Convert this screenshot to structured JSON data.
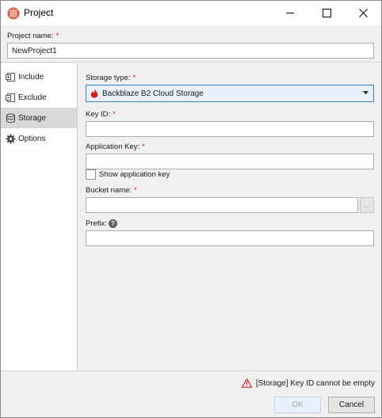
{
  "window": {
    "title": "Project",
    "app_icon": "project-app-icon",
    "controls": [
      "minimize-icon",
      "maximize-icon",
      "close-icon"
    ]
  },
  "project_name": {
    "label": "Project name:",
    "required_mark": "*",
    "value": "NewProject1"
  },
  "sidebar": {
    "items": [
      {
        "label": "Include",
        "icon": "include-icon",
        "active": false
      },
      {
        "label": "Exclude",
        "icon": "exclude-icon",
        "active": false
      },
      {
        "label": "Storage",
        "icon": "database-icon",
        "active": true
      },
      {
        "label": "Options",
        "icon": "gear-icon",
        "active": false
      }
    ]
  },
  "storage": {
    "type_label": "Storage type:",
    "type_value": "Backblaze B2 Cloud Storage",
    "type_icon": "backblaze-flame-icon",
    "key_id_label": "Key ID:",
    "key_id_value": "",
    "app_key_label": "Application Key:",
    "app_key_value": "",
    "show_key_label": "Show application key",
    "show_key_checked": false,
    "bucket_label": "Bucket name:",
    "bucket_value": "",
    "browse_label": "...",
    "prefix_label": "Prefix:",
    "prefix_value": "",
    "required_mark": "*"
  },
  "footer": {
    "error_text": "[Storage] Key ID cannot be empty",
    "ok_label": "OK",
    "cancel_label": "Cancel"
  },
  "colors": {
    "required": "#d81c1c",
    "accent": "#3c7fd6",
    "app_icon": "#d9583a",
    "warning": "#d81c1c"
  }
}
